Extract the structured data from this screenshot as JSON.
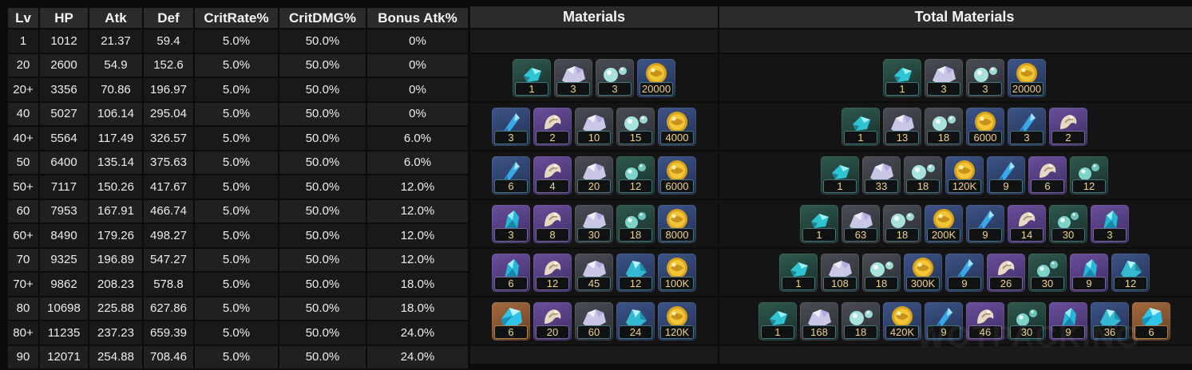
{
  "headers": [
    "Lv",
    "HP",
    "Atk",
    "Def",
    "CritRate%",
    "CritDMG%",
    "Bonus Atk%"
  ],
  "rows": [
    [
      "1",
      "1012",
      "21.37",
      "59.4",
      "5.0%",
      "50.0%",
      "0%"
    ],
    [
      "20",
      "2600",
      "54.9",
      "152.6",
      "5.0%",
      "50.0%",
      "0%"
    ],
    [
      "20+",
      "3356",
      "70.86",
      "196.97",
      "5.0%",
      "50.0%",
      "0%"
    ],
    [
      "40",
      "5027",
      "106.14",
      "295.04",
      "5.0%",
      "50.0%",
      "0%"
    ],
    [
      "40+",
      "5564",
      "117.49",
      "326.57",
      "5.0%",
      "50.0%",
      "6.0%"
    ],
    [
      "50",
      "6400",
      "135.14",
      "375.63",
      "5.0%",
      "50.0%",
      "6.0%"
    ],
    [
      "50+",
      "7117",
      "150.26",
      "417.67",
      "5.0%",
      "50.0%",
      "12.0%"
    ],
    [
      "60",
      "7953",
      "167.91",
      "466.74",
      "5.0%",
      "50.0%",
      "12.0%"
    ],
    [
      "60+",
      "8490",
      "179.26",
      "498.27",
      "5.0%",
      "50.0%",
      "12.0%"
    ],
    [
      "70",
      "9325",
      "196.89",
      "547.27",
      "5.0%",
      "50.0%",
      "12.0%"
    ],
    [
      "70+",
      "9862",
      "208.23",
      "578.8",
      "5.0%",
      "50.0%",
      "18.0%"
    ],
    [
      "80",
      "10698",
      "225.88",
      "627.86",
      "5.0%",
      "50.0%",
      "18.0%"
    ],
    [
      "80+",
      "11235",
      "237.23",
      "659.39",
      "5.0%",
      "50.0%",
      "24.0%"
    ],
    [
      "90",
      "12071",
      "254.88",
      "708.46",
      "5.0%",
      "50.0%",
      "24.0%"
    ]
  ],
  "materials_header": "Materials",
  "total_header": "Total Materials",
  "materials": [
    [
      {
        "icon": "cyan-crystal-icon",
        "rarity": "r2",
        "count": "1"
      },
      {
        "icon": "silver-ore-icon",
        "rarity": "rg",
        "count": "3"
      },
      {
        "icon": "pearl-orbs-icon",
        "rarity": "rg",
        "count": "3"
      },
      {
        "icon": "gold-coin-icon",
        "rarity": "r3",
        "count": "20000"
      }
    ],
    [
      {
        "icon": "blue-shard-icon",
        "rarity": "r3",
        "count": "3"
      },
      {
        "icon": "horn-icon",
        "rarity": "r4",
        "count": "2"
      },
      {
        "icon": "silver-ore-icon",
        "rarity": "rg",
        "count": "10"
      },
      {
        "icon": "pearl-orbs-icon",
        "rarity": "rg",
        "count": "15"
      },
      {
        "icon": "gold-coin-icon",
        "rarity": "r3",
        "count": "4000"
      }
    ],
    [
      {
        "icon": "blue-shard-icon",
        "rarity": "r3",
        "count": "6"
      },
      {
        "icon": "horn-icon",
        "rarity": "r4",
        "count": "4"
      },
      {
        "icon": "silver-ore-icon",
        "rarity": "rg",
        "count": "20"
      },
      {
        "icon": "green-orbs-icon",
        "rarity": "r2",
        "count": "12"
      },
      {
        "icon": "gold-coin-icon",
        "rarity": "r3",
        "count": "6000"
      }
    ],
    [
      {
        "icon": "violet-crystal-icon",
        "rarity": "r4",
        "count": "3"
      },
      {
        "icon": "horn-icon",
        "rarity": "r4",
        "count": "8"
      },
      {
        "icon": "silver-ore-icon",
        "rarity": "rg",
        "count": "30"
      },
      {
        "icon": "green-orbs-icon",
        "rarity": "r2",
        "count": "18"
      },
      {
        "icon": "gold-coin-icon",
        "rarity": "r3",
        "count": "8000"
      }
    ],
    [
      {
        "icon": "violet-crystal-icon",
        "rarity": "r4",
        "count": "6"
      },
      {
        "icon": "horn-icon",
        "rarity": "r4",
        "count": "12"
      },
      {
        "icon": "silver-ore-icon",
        "rarity": "rg",
        "count": "45"
      },
      {
        "icon": "aqua-crystal-icon",
        "rarity": "r3",
        "count": "12"
      },
      {
        "icon": "gold-coin-icon",
        "rarity": "r3",
        "count": "100K"
      }
    ],
    [
      {
        "icon": "gold-gem-icon",
        "rarity": "r5",
        "count": "6"
      },
      {
        "icon": "horn-icon",
        "rarity": "r4",
        "count": "20"
      },
      {
        "icon": "silver-ore-icon",
        "rarity": "rg",
        "count": "60"
      },
      {
        "icon": "aqua-crystal-icon",
        "rarity": "r3",
        "count": "24"
      },
      {
        "icon": "gold-coin-icon",
        "rarity": "r3",
        "count": "120K"
      }
    ]
  ],
  "totals": [
    [
      {
        "icon": "cyan-crystal-icon",
        "rarity": "r2",
        "count": "1"
      },
      {
        "icon": "silver-ore-icon",
        "rarity": "rg",
        "count": "3"
      },
      {
        "icon": "pearl-orbs-icon",
        "rarity": "rg",
        "count": "3"
      },
      {
        "icon": "gold-coin-icon",
        "rarity": "r3",
        "count": "20000"
      }
    ],
    [
      {
        "icon": "cyan-crystal-icon",
        "rarity": "r2",
        "count": "1"
      },
      {
        "icon": "silver-ore-icon",
        "rarity": "rg",
        "count": "13"
      },
      {
        "icon": "pearl-orbs-icon",
        "rarity": "rg",
        "count": "18"
      },
      {
        "icon": "gold-coin-icon",
        "rarity": "r3",
        "count": "6000"
      },
      {
        "icon": "blue-shard-icon",
        "rarity": "r3",
        "count": "3"
      },
      {
        "icon": "horn-icon",
        "rarity": "r4",
        "count": "2"
      }
    ],
    [
      {
        "icon": "cyan-crystal-icon",
        "rarity": "r2",
        "count": "1"
      },
      {
        "icon": "silver-ore-icon",
        "rarity": "rg",
        "count": "33"
      },
      {
        "icon": "pearl-orbs-icon",
        "rarity": "rg",
        "count": "18"
      },
      {
        "icon": "gold-coin-icon",
        "rarity": "r3",
        "count": "120K"
      },
      {
        "icon": "blue-shard-icon",
        "rarity": "r3",
        "count": "9"
      },
      {
        "icon": "horn-icon",
        "rarity": "r4",
        "count": "6"
      },
      {
        "icon": "green-orbs-icon",
        "rarity": "r2",
        "count": "12"
      }
    ],
    [
      {
        "icon": "cyan-crystal-icon",
        "rarity": "r2",
        "count": "1"
      },
      {
        "icon": "silver-ore-icon",
        "rarity": "rg",
        "count": "63"
      },
      {
        "icon": "pearl-orbs-icon",
        "rarity": "rg",
        "count": "18"
      },
      {
        "icon": "gold-coin-icon",
        "rarity": "r3",
        "count": "200K"
      },
      {
        "icon": "blue-shard-icon",
        "rarity": "r3",
        "count": "9"
      },
      {
        "icon": "horn-icon",
        "rarity": "r4",
        "count": "14"
      },
      {
        "icon": "green-orbs-icon",
        "rarity": "r2",
        "count": "30"
      },
      {
        "icon": "violet-crystal-icon",
        "rarity": "r4",
        "count": "3"
      }
    ],
    [
      {
        "icon": "cyan-crystal-icon",
        "rarity": "r2",
        "count": "1"
      },
      {
        "icon": "silver-ore-icon",
        "rarity": "rg",
        "count": "108"
      },
      {
        "icon": "pearl-orbs-icon",
        "rarity": "rg",
        "count": "18"
      },
      {
        "icon": "gold-coin-icon",
        "rarity": "r3",
        "count": "300K"
      },
      {
        "icon": "blue-shard-icon",
        "rarity": "r3",
        "count": "9"
      },
      {
        "icon": "horn-icon",
        "rarity": "r4",
        "count": "26"
      },
      {
        "icon": "green-orbs-icon",
        "rarity": "r2",
        "count": "30"
      },
      {
        "icon": "violet-crystal-icon",
        "rarity": "r4",
        "count": "9"
      },
      {
        "icon": "aqua-crystal-icon",
        "rarity": "r3",
        "count": "12"
      }
    ],
    [
      {
        "icon": "cyan-crystal-icon",
        "rarity": "r2",
        "count": "1"
      },
      {
        "icon": "silver-ore-icon",
        "rarity": "rg",
        "count": "168"
      },
      {
        "icon": "pearl-orbs-icon",
        "rarity": "rg",
        "count": "18"
      },
      {
        "icon": "gold-coin-icon",
        "rarity": "r3",
        "count": "420K"
      },
      {
        "icon": "blue-shard-icon",
        "rarity": "r3",
        "count": "9"
      },
      {
        "icon": "horn-icon",
        "rarity": "r4",
        "count": "46"
      },
      {
        "icon": "green-orbs-icon",
        "rarity": "r2",
        "count": "30"
      },
      {
        "icon": "violet-crystal-icon",
        "rarity": "r4",
        "count": "9"
      },
      {
        "icon": "aqua-crystal-icon",
        "rarity": "r3",
        "count": "36"
      },
      {
        "icon": "gold-gem-icon",
        "rarity": "r5",
        "count": "6"
      }
    ]
  ],
  "watermark": "WOTPACKING"
}
